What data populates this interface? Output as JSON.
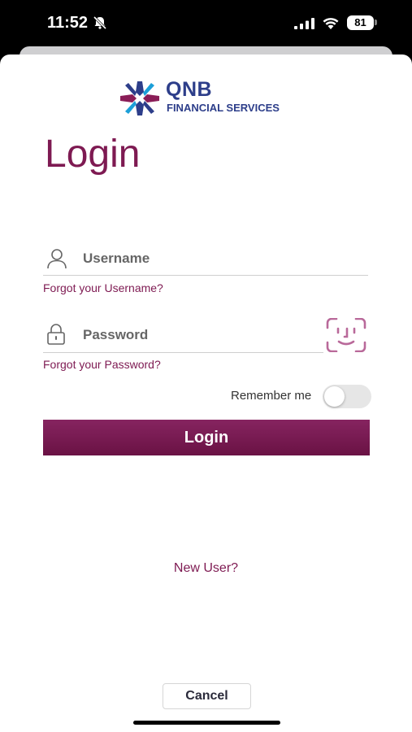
{
  "status_bar": {
    "time": "11:52",
    "battery": "81"
  },
  "logo": {
    "brand": "QNB",
    "subtitle": "FINANCIAL SERVICES"
  },
  "title": "Login",
  "username": {
    "placeholder": "Username",
    "forgot_label": "Forgot your Username?"
  },
  "password": {
    "placeholder": "Password",
    "forgot_label": "Forgot your Password?"
  },
  "remember": {
    "label": "Remember me",
    "checked": false
  },
  "login_button": {
    "label": "Login"
  },
  "new_user_label": "New User?",
  "cancel_label": "Cancel",
  "colors": {
    "accent": "#7e1a52",
    "brand_blue": "#2d3e8a"
  }
}
